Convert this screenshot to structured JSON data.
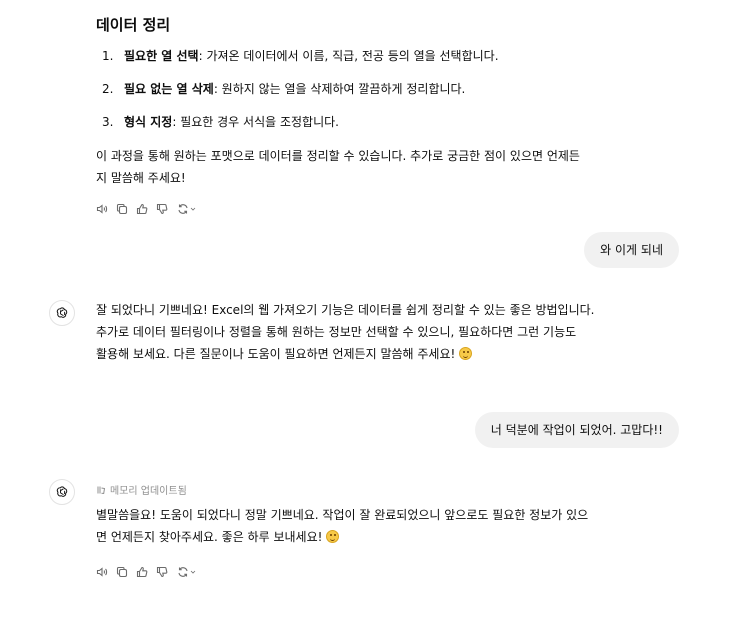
{
  "message1": {
    "heading": "데이터 정리",
    "steps": [
      {
        "num": "1.",
        "bold": "필요한 열 선택",
        "rest": ": 가져온 데이터에서 이름, 직급, 전공 등의 열을 선택합니다."
      },
      {
        "num": "2.",
        "bold": "필요 없는 열 삭제",
        "rest": ": 원하지 않는 열을 삭제하여 깔끔하게 정리합니다."
      },
      {
        "num": "3.",
        "bold": "형식 지정",
        "rest": ": 필요한 경우 서식을 조정합니다."
      }
    ],
    "closing_line1": "이 과정을 통해 원하는 포맷으로 데이터를 정리할 수 있습니다. 추가로 궁금한 점이 있으면 언제든",
    "closing_line2": "지 말씀해 주세요!"
  },
  "user_message1": "와 이게 되네",
  "message2": {
    "line1": "잘 되었다니 기쁘네요! Excel의 웹 가져오기 기능은 데이터를 쉽게 정리할 수 있는 좋은 방법입니다.",
    "line2": "추가로 데이터 필터링이나 정렬을 통해 원하는 정보만 선택할 수 있으니, 필요하다면 그런 기능도",
    "line3": "활용해 보세요. 다른 질문이나 도움이 필요하면 언제든지 말씀해 주세요!"
  },
  "user_message2": "너 덕분에 작업이 되었어. 고맙다!!",
  "message3": {
    "memory_label": "메모리 업데이트됨",
    "line1": "별말씀을요! 도움이 되었다니 정말 기쁘네요. 작업이 잘 완료되었으니 앞으로도 필요한 정보가 있으",
    "line2": "면 언제든지 찾아주세요. 좋은 하루 보내세요!"
  },
  "icons": {
    "read_aloud": "speaker-icon",
    "copy": "copy-icon",
    "thumbs_up": "thumbs-up-icon",
    "thumbs_down": "thumbs-down-icon",
    "regenerate": "regenerate-icon",
    "assistant_avatar": "openai-logo-icon",
    "memory": "memory-icon",
    "emoji": "smiling-face-emoji"
  },
  "colors": {
    "user_bubble": "#f1f1f1",
    "icon_gray": "#6b6b6b",
    "memory_text": "#8f8f8f"
  }
}
